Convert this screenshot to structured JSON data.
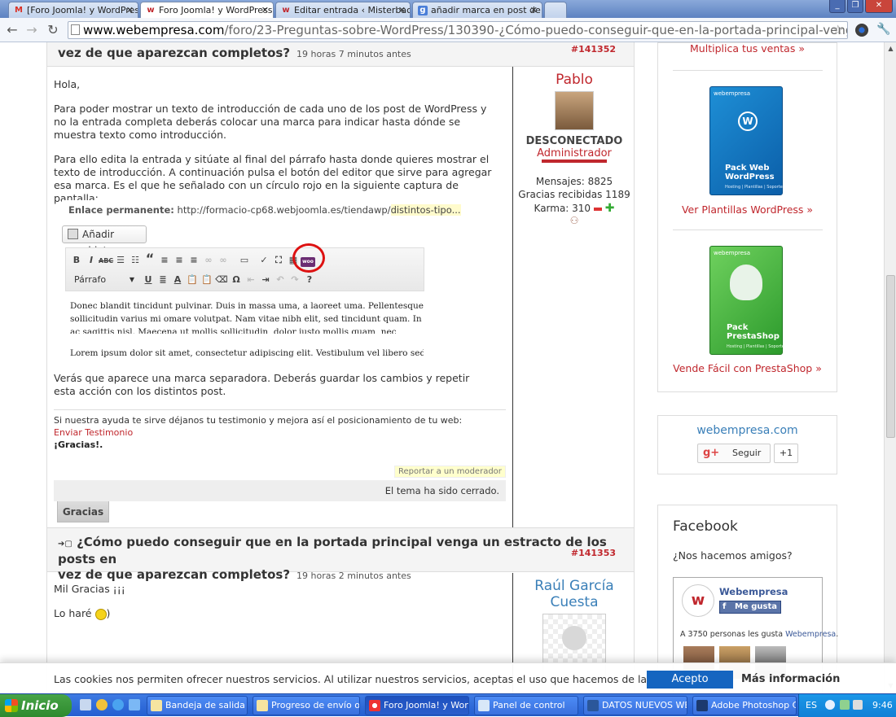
{
  "browser": {
    "tabs": [
      {
        "label": "[Foro Joomla! y WordPress]",
        "icon": "gmail-icon"
      },
      {
        "label": "Foro Joomla! y WordPress ::",
        "icon": "webempresa-icon",
        "active": true
      },
      {
        "label": "Editar entrada ‹ Misterbacks",
        "icon": "webempresa-icon"
      },
      {
        "label": "añadir marca en post de wor",
        "icon": "google-icon"
      }
    ],
    "url_domain": "www.webempresa.com",
    "url_path": "/foro/23-Preguntas-sobre-WordPress/130390-¿Cómo-puedo-conseguir-que-en-la-portada-principal-venga-un-estracto-de-los-pc"
  },
  "post1": {
    "title_line2": "vez de que aparezcan completos?",
    "time": "19 horas 7 minutos antes",
    "number": "#141352",
    "p1": "Hola,",
    "p2": "Para poder mostrar un texto de introducción de cada uno de los post de WordPress y no la entrada completa deberás colocar una marca para indicar hasta dónde se muestra texto como introducción.",
    "p3": "Para ello edita la entrada y sitúate al final del párrafo hasta donde quieres mostrar el texto de introducción. A continuación pulsa el botón del editor que sirve para agregar esa marca. Es el que he señalado con un círculo rojo en la siguiente captura de pantalla:",
    "shot_permalink_label": "Enlace permanente:",
    "shot_permalink_url": "http://formacio-cp68.webjoomla.es/tiendawp/",
    "shot_permalink_slug": "distintos-tipo...",
    "shot_add_object": "Añadir objeto",
    "shot_format": "Párrafo",
    "shot_text1": "Donec blandit tincidunt pulvinar. Duis in massa uma, a laoreet uma. Pellentesque sollicitudin varius mi omare volutpat. Nam vitae nibh elit, sed tincidunt quam. In ac sagittis nisl. Maecena ut mollis sollicitudin, dolor justo mollis quam, nec fermentum lectus neque eget mauris.",
    "shot_text2": "Lorem ipsum dolor sit amet, consectetur adipiscing elit. Vestibulum vel libero sed nibh placer",
    "p4": "Verás que aparece una marca separadora. Deberás guardar los cambios y repetir esta acción con los distintos post.",
    "sig1": "Si nuestra ayuda te sirve déjanos tu testimonio y mejora así el posicionamiento de tu web:",
    "sig_link": "Enviar Testimonio",
    "sig_thanks": "¡Gracias!.",
    "report": "Reportar a un moderador",
    "closed": "El tema ha sido cerrado.",
    "thanks_button": "Gracias",
    "author": {
      "name": "Pablo",
      "status": "DESCONECTADO",
      "role": "Administrador",
      "messages": "Mensajes: 8825",
      "gratitude": "Gracias recibidas 1189",
      "karma": "Karma: 310"
    }
  },
  "post2": {
    "title_line1": "¿Cómo puedo conseguir que en la portada principal venga un estracto de los posts en",
    "title_line2": "vez de que aparezcan completos?",
    "time": "19 horas 2 minutos antes",
    "number": "#141353",
    "p1": "Mil Gracias ¡¡¡",
    "p2": "Lo haré",
    "p2_end": ")",
    "author_name": "Raúl García Cuesta"
  },
  "sidebar": {
    "top_link": "Multiplica tus ventas »",
    "product1_brand": "webempresa",
    "product1_title": "Pack Web WordPress",
    "product1_sub": "Hosting | Plantillas | Soporte",
    "product1_link": "Ver Plantillas WordPress »",
    "product2_brand": "webempresa",
    "product2_title": "Pack PrestaShop",
    "product2_sub": "Hosting | Plantillas | Soporte",
    "product2_link": "Vende Fácil con PrestaShop »",
    "gplus_title": "webempresa.com",
    "gplus_follow": "Seguir",
    "gplus_count": "+1",
    "fb_title": "Facebook",
    "fb_sub": "¿Nos hacemos amigos?",
    "fb_page": "Webempresa",
    "fb_like": "Me gusta",
    "fb_count_pre": "A 3750 personas les gusta ",
    "fb_count_link": "Webempresa",
    "fb_count_post": "."
  },
  "cookies": {
    "text": "Las cookies nos permiten ofrecer nuestros servicios. Al utilizar nuestros servicios, aceptas el uso que hacemos de las cookies",
    "accept": "Acepto",
    "more": "Más información"
  },
  "taskbar": {
    "start": "Inicio",
    "items": [
      "Bandeja de salida - ...",
      "Progreso de envío o ...",
      "Foro Joomla! y Word...",
      "Panel de control",
      "DATOS NUEVOS WE...",
      "Adobe Photoshop CS3"
    ],
    "lang": "ES",
    "clock": "9:46"
  },
  "colors": {
    "brand_red": "#c0272d",
    "accept_blue": "#1565c0"
  }
}
